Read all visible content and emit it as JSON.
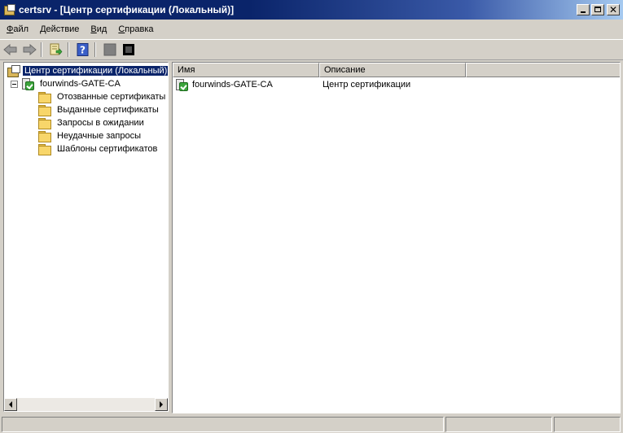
{
  "window": {
    "title": "certsrv - [Центр сертификации (Локальный)]",
    "controls": {
      "minimize": "_",
      "maximize": "□",
      "close": "✕"
    }
  },
  "menu": [
    {
      "label": "Файл",
      "accel": "Ф",
      "rest": "айл"
    },
    {
      "label": "Действие",
      "accel": "Д",
      "rest": "ействие"
    },
    {
      "label": "Вид",
      "accel": "В",
      "rest": "ид"
    },
    {
      "label": "Справка",
      "accel": "С",
      "rest": "правка"
    }
  ],
  "toolbar": {
    "icons": [
      "back-arrow-icon",
      "forward-arrow-icon",
      "export-list-icon",
      "help-icon",
      "start-service-icon",
      "stop-service-icon"
    ]
  },
  "tree": {
    "root": "Центр сертификации (Локальный)",
    "ca": "fourwinds-GATE-CA",
    "folders": [
      "Отозванные сертификаты",
      "Выданные сертификаты",
      "Запросы в ожидании",
      "Неудачные запросы",
      "Шаблоны сертификатов"
    ]
  },
  "list": {
    "columns": [
      "Имя",
      "Описание"
    ],
    "rows": [
      {
        "name": "fourwinds-GATE-CA",
        "description": "Центр сертификации"
      }
    ]
  },
  "colors": {
    "titlebar_start": "#0a246a",
    "titlebar_end": "#a6caf0",
    "face": "#d4d0c8",
    "selection": "#0a246a"
  }
}
